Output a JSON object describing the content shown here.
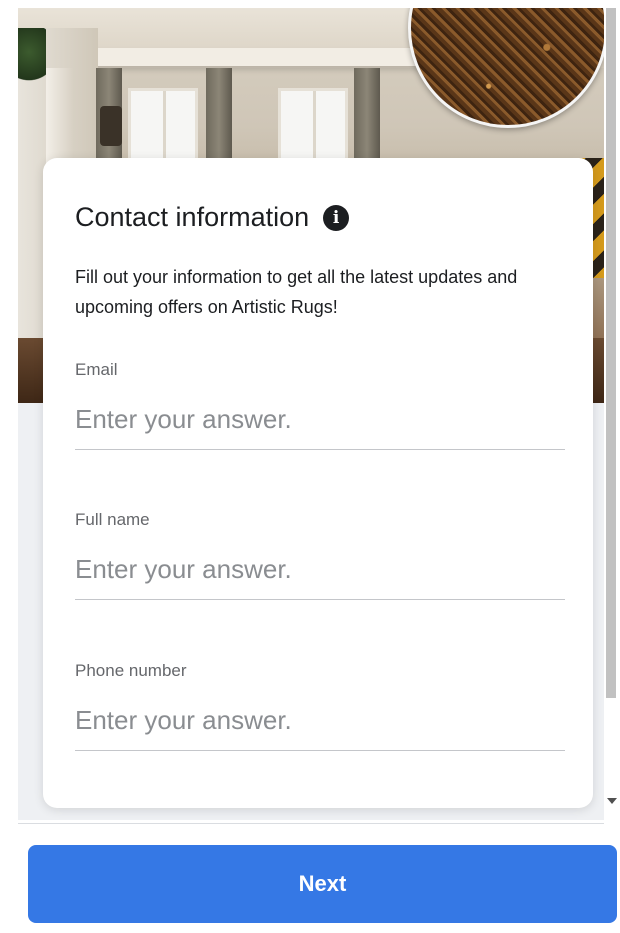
{
  "form": {
    "title": "Contact information",
    "description": "Fill out your information to get all the latest updates and upcoming offers on Artistic Rugs!",
    "fields": [
      {
        "label": "Email",
        "value": "",
        "placeholder": "Enter your answer."
      },
      {
        "label": "Full name",
        "value": "",
        "placeholder": "Enter your answer."
      },
      {
        "label": "Phone number",
        "value": "",
        "placeholder": "Enter your answer."
      }
    ]
  },
  "footer": {
    "next_label": "Next"
  },
  "icons": {
    "title_info": "info-icon",
    "scroll_down": "chevron-down-icon"
  },
  "colors": {
    "primary_button": "#3578e5",
    "card_background": "#ffffff",
    "page_background": "#eef0f3",
    "text_primary": "#1c1e21",
    "text_secondary": "#65676b"
  }
}
